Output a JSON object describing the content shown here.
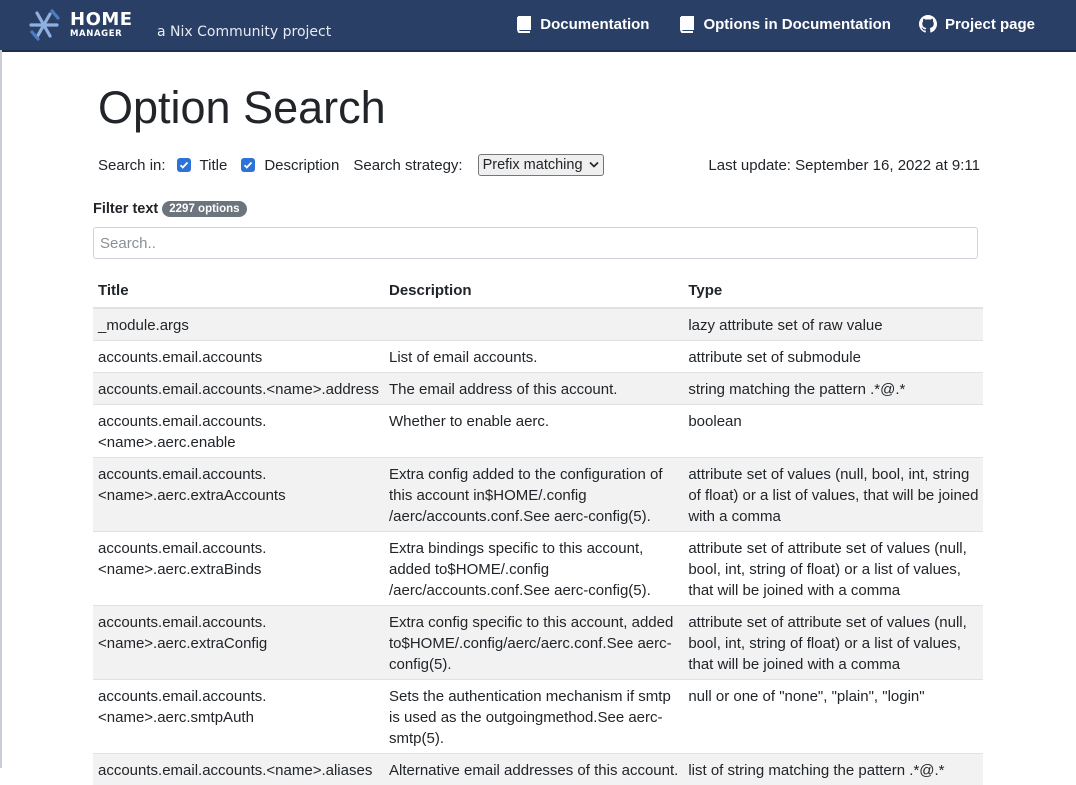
{
  "header": {
    "brand_home": "HOME",
    "brand_manager": "MANAGER",
    "tagline": "a Nix Community project",
    "nav": [
      {
        "label": "Documentation",
        "icon": "book-icon"
      },
      {
        "label": "Options in Documentation",
        "icon": "book-icon"
      },
      {
        "label": "Project page",
        "icon": "github-icon"
      }
    ]
  },
  "page": {
    "title": "Option Search",
    "search_in_label": "Search in:",
    "title_checkbox_label": "Title",
    "title_checked": true,
    "description_checkbox_label": "Description",
    "description_checked": true,
    "strategy_label": "Search strategy:",
    "strategy_value": "Prefix matching",
    "last_update": "Last update: September 16, 2022 at 9:11",
    "filter_label": "Filter text",
    "options_count": "2297 options",
    "search_placeholder": "Search.."
  },
  "table": {
    "headers": [
      "Title",
      "Description",
      "Type"
    ],
    "rows": [
      {
        "title": [
          "_module.args"
        ],
        "description": [],
        "type": [
          "lazy attribute set of raw value"
        ]
      },
      {
        "title": [
          "accounts.email.accounts"
        ],
        "description": [
          "List of email accounts."
        ],
        "type": [
          "attribute set of submodule"
        ]
      },
      {
        "title": [
          "accounts.email.accounts.<name>.address"
        ],
        "description": [
          "The email address of this account."
        ],
        "type": [
          "string matching the pattern .*@.*"
        ]
      },
      {
        "title": [
          "accounts.email.accounts.",
          "<name>.aerc.enable"
        ],
        "description": [
          "Whether to enable aerc."
        ],
        "type": [
          "boolean"
        ]
      },
      {
        "title": [
          "accounts.email.accounts.",
          "<name>.aerc.extraAccounts"
        ],
        "description": [
          "Extra config added to the configuration of",
          "this account in$HOME/.config",
          "/aerc/accounts.conf.See aerc-config(5)."
        ],
        "type": [
          "attribute set of values (null, bool, int, string",
          "of float) or a list of values, that will be joined",
          "with a comma"
        ]
      },
      {
        "title": [
          "accounts.email.accounts.",
          "<name>.aerc.extraBinds"
        ],
        "description": [
          "Extra bindings specific to this account,",
          "added to$HOME/.config",
          "/aerc/accounts.conf.See aerc-config(5)."
        ],
        "type": [
          "attribute set of attribute set of values (null,",
          "bool, int, string of float) or a list of values,",
          "that will be joined with a comma"
        ]
      },
      {
        "title": [
          "accounts.email.accounts.",
          "<name>.aerc.extraConfig"
        ],
        "description": [
          "Extra config specific to this account, added",
          "to$HOME/.config/aerc/aerc.conf.See aerc-",
          "config(5)."
        ],
        "type": [
          "attribute set of attribute set of values (null,",
          "bool, int, string of float) or a list of values,",
          "that will be joined with a comma"
        ]
      },
      {
        "title": [
          "accounts.email.accounts.",
          "<name>.aerc.smtpAuth"
        ],
        "description": [
          "Sets the authentication mechanism if smtp",
          "is used as the outgoingmethod.See aerc-",
          "smtp(5)."
        ],
        "type": [
          "null or one of \"none\", \"plain\", \"login\""
        ]
      },
      {
        "title": [
          "accounts.email.accounts.<name>.aliases"
        ],
        "description": [
          "Alternative email addresses of this account."
        ],
        "type": [
          "list of string matching the pattern .*@.*"
        ]
      }
    ]
  },
  "colors": {
    "navbar": "#2a3f66",
    "checkbox": "#2d72d9",
    "badge": "#6c757d"
  }
}
